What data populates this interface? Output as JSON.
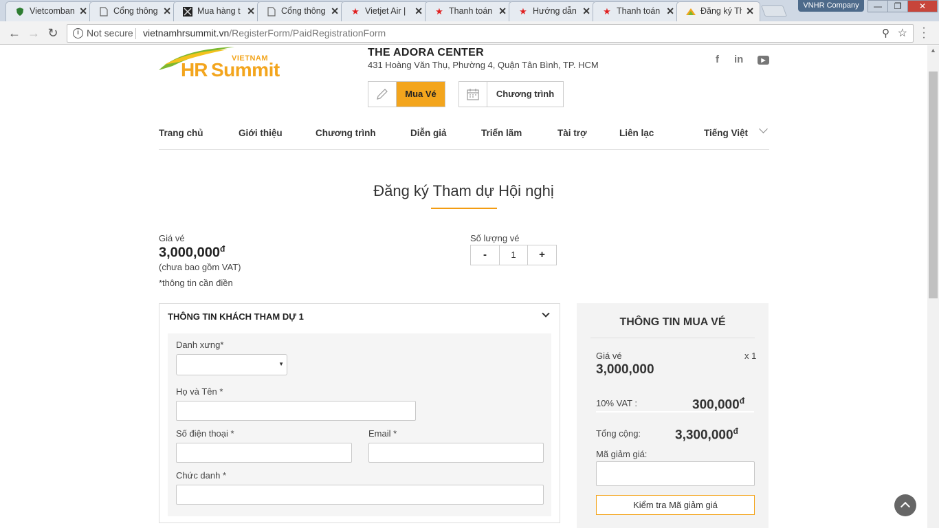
{
  "browser": {
    "tabs": [
      {
        "label": "Vietcombank",
        "icon": "shield-icon",
        "color": "#2e7d32"
      },
      {
        "label": "Cổng thông tin",
        "icon": "page-icon",
        "color": "#666666"
      },
      {
        "label": "Mua hàng t",
        "icon": "pattern-icon",
        "color": "#222222"
      },
      {
        "label": "Cổng thông tin",
        "icon": "page-icon",
        "color": "#666666"
      },
      {
        "label": "Vietjet Air |",
        "icon": "star-icon",
        "color": "#e02020"
      },
      {
        "label": "Thanh toán",
        "icon": "star-icon",
        "color": "#e02020"
      },
      {
        "label": "Hướng dẫn",
        "icon": "star-icon",
        "color": "#e02020"
      },
      {
        "label": "Thanh toán",
        "icon": "star-icon",
        "color": "#e02020"
      },
      {
        "label": "Đăng ký Th",
        "icon": "logo-icon",
        "color": "#f3a51d"
      }
    ],
    "profile": "VNHR Company",
    "security": "Not secure",
    "url_host": "vietnamhrsummit.vn",
    "url_path": "/RegisterForm/PaidRegistrationForm"
  },
  "header": {
    "logo_top": "VIETNAM",
    "logo_hr": "HR",
    "logo_summit": "Summit",
    "venue_name": "THE ADORA CENTER",
    "venue_address": "431 Hoàng Văn Thụ, Phường 4, Quận Tân Bình, TP. HCM",
    "buy_label": "Mua Vé",
    "program_label": "Chương trình",
    "social": [
      "f",
      "in",
      "▶"
    ]
  },
  "nav": {
    "items": [
      "Trang chủ",
      "Giới thiệu",
      "Chương trình",
      "Diễn giả",
      "Triển lãm",
      "Tài trợ",
      "Liên lạc"
    ],
    "language": "Tiếng Việt"
  },
  "page": {
    "title": "Đăng ký Tham dự Hội nghị",
    "price_label": "Giá vé",
    "price_value": "3,000,000",
    "currency": "đ",
    "vat_note": "(chưa bao gồm VAT)",
    "required_note": "*thông tin cần điền",
    "qty_label": "Số lượng vé",
    "qty_minus": "-",
    "qty_value": "1",
    "qty_plus": "+"
  },
  "guest": {
    "title": "THÔNG TIN KHÁCH THAM DỰ 1",
    "salutation_label": "Danh xưng*",
    "salutation_value": "",
    "fullname_label": "Họ và Tên *",
    "phone_label": "Số điện thoại *",
    "email_label": "Email *",
    "jobtitle_label": "Chức danh *"
  },
  "summary": {
    "title": "THÔNG TIN MUA VÉ",
    "price_label": "Giá vé",
    "multiplier": "x 1",
    "price_value": "3,000,000",
    "vat_label": "10% VAT :",
    "vat_value": "300,000",
    "total_label": "Tổng cộng:",
    "total_value": "3,300,000",
    "currency": "đ",
    "coupon_label": "Mã giảm giá:",
    "coupon_button": "Kiểm tra Mã giảm giá"
  },
  "colors": {
    "accent": "#f3a51d",
    "underline": "#f39c12",
    "logo_green": "#7cb82f"
  }
}
